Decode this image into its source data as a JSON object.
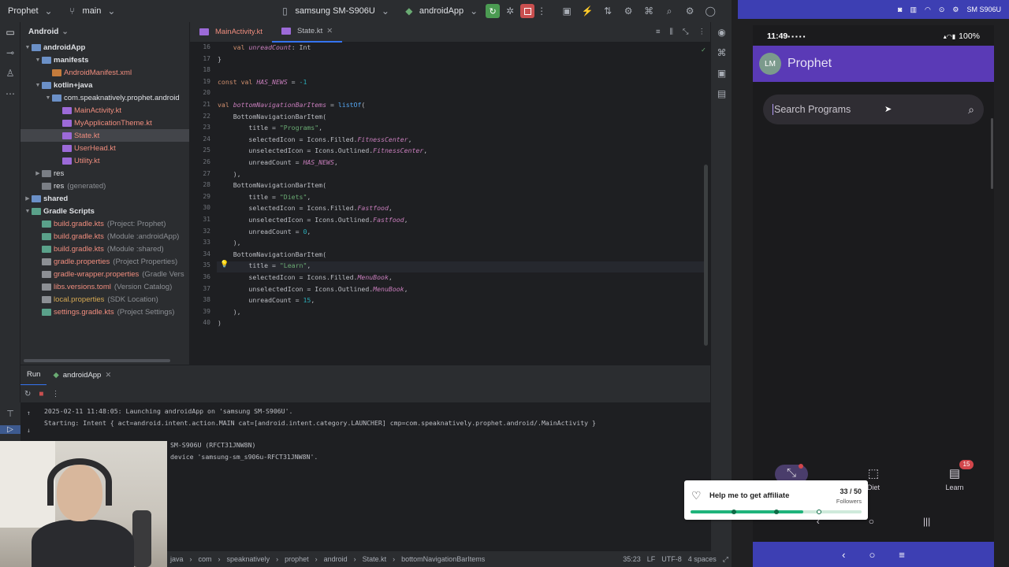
{
  "toolbar": {
    "project_name": "Prophet",
    "branch": "main",
    "device": "samsung SM-S906U",
    "run_config": "androidApp"
  },
  "project_panel": {
    "view_mode": "Android",
    "tree": [
      {
        "label": "androidApp",
        "depth": 0,
        "type": "folder",
        "expanded": true,
        "color": "#dfe1e5"
      },
      {
        "label": "manifests",
        "depth": 1,
        "type": "folder",
        "expanded": true,
        "color": "#dfe1e5"
      },
      {
        "label": "AndroidManifest.xml",
        "depth": 2,
        "type": "xml",
        "color": "#f08d7e"
      },
      {
        "label": "kotlin+java",
        "depth": 1,
        "type": "folder",
        "expanded": true,
        "color": "#dfe1e5"
      },
      {
        "label": "com.speaknatively.prophet.android",
        "depth": 2,
        "type": "folder",
        "expanded": true,
        "color": "#dfe1e5"
      },
      {
        "label": "MainActivity.kt",
        "depth": 3,
        "type": "kt",
        "color": "#f08d7e"
      },
      {
        "label": "MyApplicationTheme.kt",
        "depth": 3,
        "type": "kt",
        "color": "#f08d7e"
      },
      {
        "label": "State.kt",
        "depth": 3,
        "type": "kt",
        "color": "#f08d7e",
        "selected": true
      },
      {
        "label": "UserHead.kt",
        "depth": 3,
        "type": "kt",
        "color": "#f08d7e"
      },
      {
        "label": "Utility.kt",
        "depth": 3,
        "type": "kt",
        "color": "#f08d7e"
      },
      {
        "label": "res",
        "depth": 1,
        "type": "res",
        "collapsed": true,
        "color": "#dfe1e5"
      },
      {
        "label": "res",
        "suffix": "(generated)",
        "depth": 1,
        "type": "res",
        "color": "#dfe1e5"
      },
      {
        "label": "shared",
        "depth": 0,
        "type": "folder",
        "collapsed": true,
        "color": "#dfe1e5"
      },
      {
        "label": "Gradle Scripts",
        "depth": 0,
        "type": "gradle",
        "expanded": true,
        "color": "#dfe1e5"
      },
      {
        "label": "build.gradle.kts",
        "suffix": "(Project: Prophet)",
        "depth": 1,
        "type": "gradle",
        "color": "#f08d7e"
      },
      {
        "label": "build.gradle.kts",
        "suffix": "(Module :androidApp)",
        "depth": 1,
        "type": "gradle",
        "color": "#f08d7e"
      },
      {
        "label": "build.gradle.kts",
        "suffix": "(Module :shared)",
        "depth": 1,
        "type": "gradle",
        "color": "#f08d7e"
      },
      {
        "label": "gradle.properties",
        "suffix": "(Project Properties)",
        "depth": 1,
        "type": "prop",
        "color": "#f08d7e"
      },
      {
        "label": "gradle-wrapper.properties",
        "suffix": "(Gradle Vers",
        "depth": 1,
        "type": "prop",
        "color": "#f08d7e"
      },
      {
        "label": "libs.versions.toml",
        "suffix": "(Version Catalog)",
        "depth": 1,
        "type": "prop",
        "color": "#f08d7e"
      },
      {
        "label": "local.properties",
        "suffix": "(SDK Location)",
        "depth": 1,
        "type": "prop",
        "color": "#d6a953"
      },
      {
        "label": "settings.gradle.kts",
        "suffix": "(Project Settings)",
        "depth": 1,
        "type": "gradle",
        "color": "#f08d7e"
      }
    ]
  },
  "editor": {
    "tabs": [
      {
        "label": "MainActivity.kt",
        "active": false
      },
      {
        "label": "State.kt",
        "active": true
      }
    ],
    "lines": [
      {
        "n": "16",
        "html": "    <span class='kw'>val</span> <span class='it'>unreadCount</span>: Int"
      },
      {
        "n": "17",
        "html": "}"
      },
      {
        "n": "18",
        "html": ""
      },
      {
        "n": "19",
        "html": "<span class='kw'>const val</span> <span class='it'>HAS_NEWS</span> = <span class='nm'>-1</span>"
      },
      {
        "n": "20",
        "html": ""
      },
      {
        "n": "21",
        "html": "<span class='kw'>val</span> <span class='it'>bottomNavigationBarItems</span> = <span class='fn'>listOf</span>("
      },
      {
        "n": "22",
        "html": "    BottomNavigationBarItem("
      },
      {
        "n": "23",
        "html": "        title = <span class='st'>\"Programs\"</span>,"
      },
      {
        "n": "24",
        "html": "        selectedIcon = Icons.Filled.<span class='it'>FitnessCenter</span>,"
      },
      {
        "n": "25",
        "html": "        unselectedIcon = Icons.Outlined.<span class='it'>FitnessCenter</span>,"
      },
      {
        "n": "26",
        "html": "        unreadCount = <span class='it'>HAS_NEWS</span>,"
      },
      {
        "n": "27",
        "html": "    ),"
      },
      {
        "n": "28",
        "html": "    BottomNavigationBarItem("
      },
      {
        "n": "29",
        "html": "        title = <span class='st'>\"Diets\"</span>,"
      },
      {
        "n": "30",
        "html": "        selectedIcon = Icons.Filled.<span class='it'>Fastfood</span>,"
      },
      {
        "n": "31",
        "html": "        unselectedIcon = Icons.Outlined.<span class='it'>Fastfood</span>,"
      },
      {
        "n": "32",
        "html": "        unreadCount = <span class='nm'>0</span>,"
      },
      {
        "n": "33",
        "html": "    ),"
      },
      {
        "n": "34",
        "html": "    BottomNavigationBarItem("
      },
      {
        "n": "35",
        "html": "        title = <span class='st'>\"Learn\"</span>,"
      },
      {
        "n": "36",
        "html": "        selectedIcon = Icons.Filled.<span class='it'>MenuBook</span>,"
      },
      {
        "n": "37",
        "html": "        unselectedIcon = Icons.Outlined.<span class='it'>MenuBook</span>,"
      },
      {
        "n": "38",
        "html": "        unreadCount = <span class='nm'>15</span>,"
      },
      {
        "n": "39",
        "html": "    ),"
      },
      {
        "n": "40",
        "html": ")"
      }
    ]
  },
  "run_panel": {
    "tab_label": "Run",
    "config_tab": "androidApp",
    "console": [
      "2025-02-11 11:48:05: Launching androidApp on 'samsung SM-S906U'.",
      "Starting: Intent { act=android.intent.action.MAIN cat=[android.intent.category.LAUNCHER] cmp=com.speaknatively.prophet.android/.MainActivity }"
    ],
    "device_link": "SM-S906U (RFCT31JNW8N)",
    "device_line": "device 'samsung-sm_s906u-RFCT31JNW8N'."
  },
  "status_bar": {
    "breadcrumbs": [
      "java",
      "com",
      "speaknatively",
      "prophet",
      "android",
      "State.kt",
      "bottomNavigationBarItems"
    ],
    "cursor": "35:23",
    "line_sep": "LF",
    "encoding": "UTF-8",
    "indent": "4 spaces"
  },
  "device_mirror": {
    "device_label": "SM S906U"
  },
  "phone": {
    "time": "11:49",
    "battery": "100%",
    "avatar_initials": "LM",
    "app_title": "Prophet",
    "search_placeholder": "Search Programs",
    "nav": [
      {
        "label": "",
        "glyph": "⤡",
        "icon": "fitness-center-icon"
      },
      {
        "label": "Diet",
        "glyph": "⬚",
        "icon": "fastfood-icon"
      },
      {
        "label": "Learn",
        "glyph": "▤",
        "icon": "menu-book-icon"
      }
    ],
    "learn_badge": "15"
  },
  "affiliate": {
    "title": "Help me to get affiliate",
    "count": "33 / 50",
    "label": "Followers",
    "progress": 0.66
  },
  "colors": {
    "app_bar": "#5a3ab6",
    "mirror_chrome": "#3d3fb3",
    "run_button": "#4b9b52",
    "stop_button": "#c94f4f",
    "progress": "#1fb37b"
  }
}
